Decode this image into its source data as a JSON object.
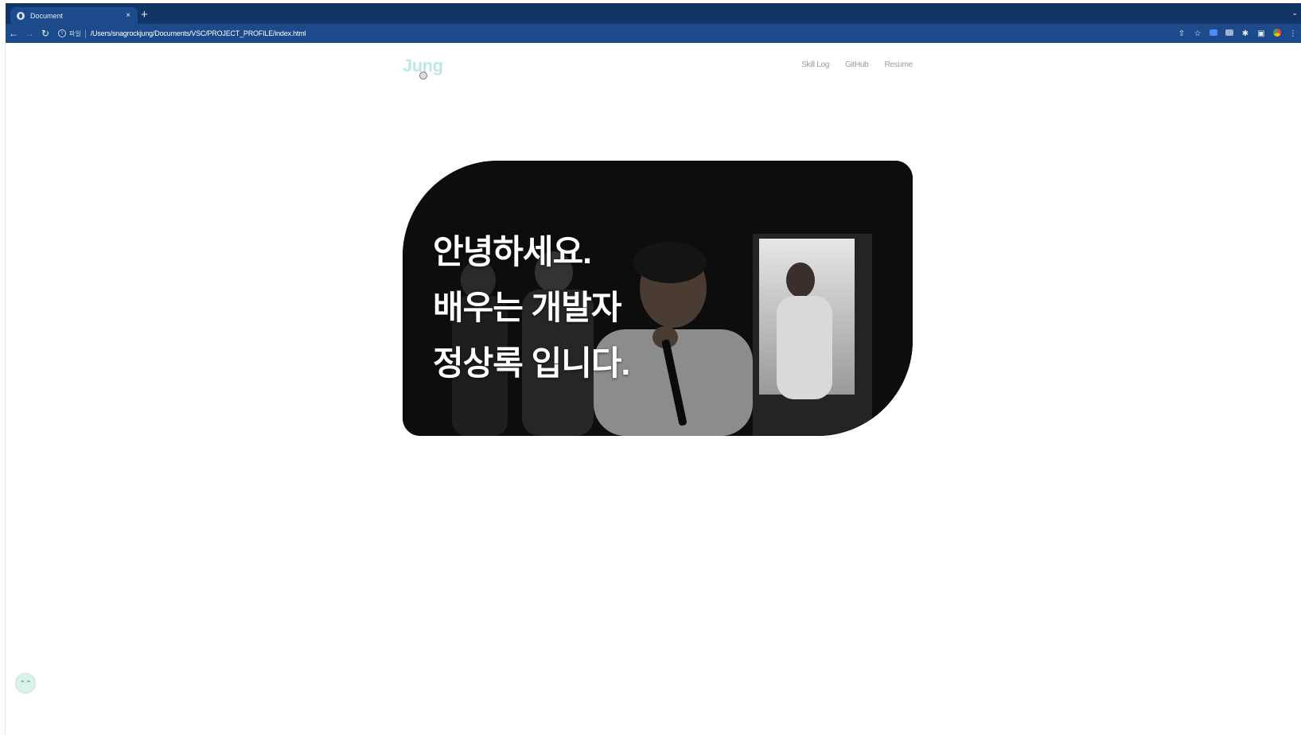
{
  "browser": {
    "tab_title": "Document",
    "tab_close": "×",
    "new_tab": "+",
    "scheme_label": "파일",
    "url": "/Users/snagrockjung/Documents/VSC/PROJECT_PROFILE/index.html",
    "nav_icons": [
      "back-arrow-icon",
      "forward-arrow-icon",
      "reload-icon"
    ],
    "toolbar_icons": [
      "share-icon",
      "bookmark-star-icon",
      "extension-icon",
      "extension-icon",
      "puzzle-icon",
      "sidebar-icon",
      "profile-icon"
    ]
  },
  "page": {
    "logo": "Jung",
    "nav": [
      "Skill Log",
      "GitHub",
      "Resume"
    ],
    "hero": {
      "lines": [
        "안녕하세요.",
        "배우는 개발자",
        "정상록 입니다."
      ]
    },
    "scroll_top_icon": "double-chevron-up-icon"
  },
  "colors": {
    "chrome": "#123567",
    "toolbar": "#1d4a8a",
    "logo": "#bfe8e2",
    "nav_text": "#9a9a9a",
    "hero_text": "#ffffff",
    "scroll_top_bg": "#dbf1ec"
  }
}
